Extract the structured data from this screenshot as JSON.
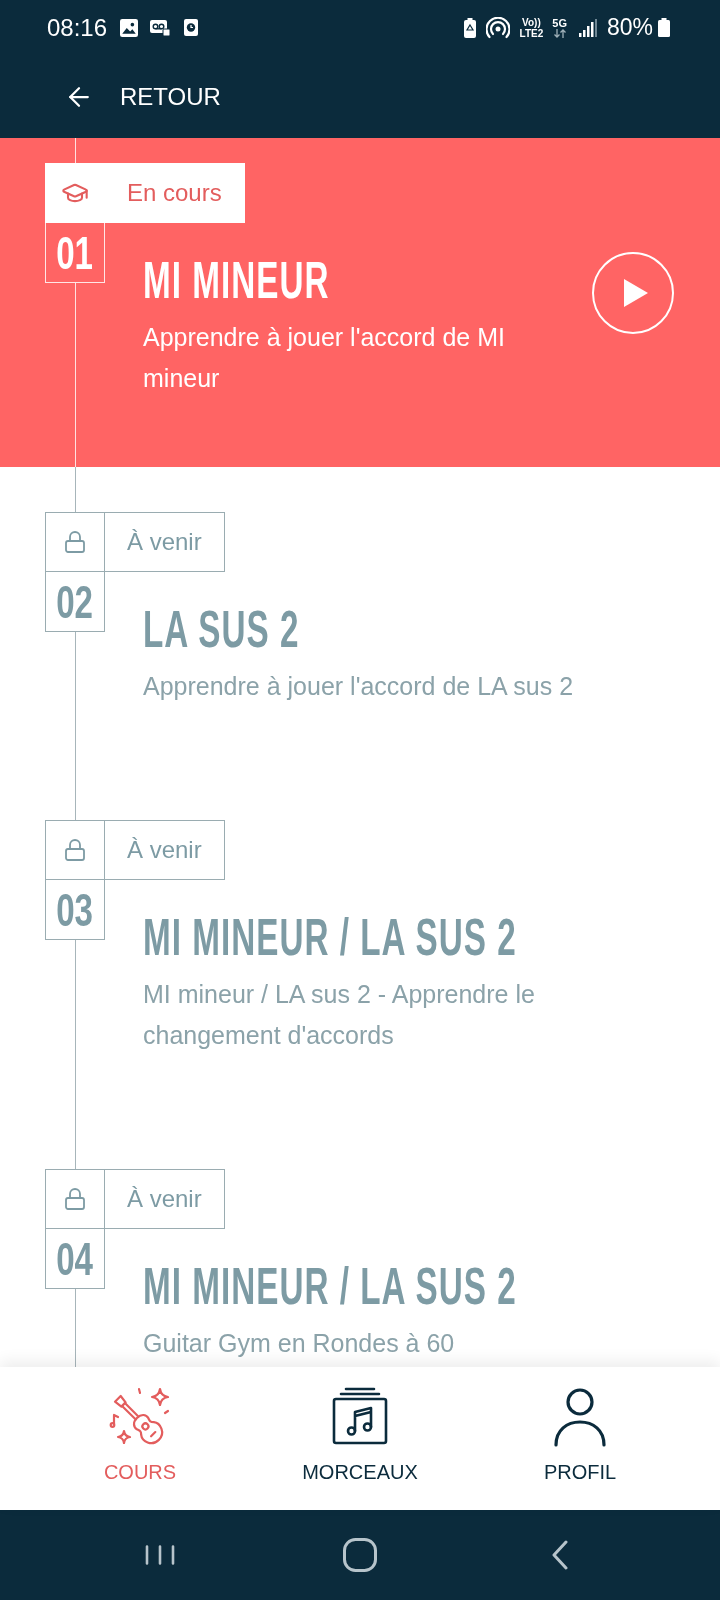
{
  "status_bar": {
    "time": "08:16",
    "volte": [
      "Vo))",
      "LTE2"
    ],
    "network_type": "5G",
    "battery": "80%"
  },
  "header": {
    "back_label": "RETOUR"
  },
  "lessons": [
    {
      "kind": "current",
      "status": "En cours",
      "number": "01",
      "title": "MI MINEUR",
      "description": "Apprendre à jouer l'accord de MI mineur"
    },
    {
      "kind": "locked",
      "status": "À venir",
      "number": "02",
      "title": "LA SUS 2",
      "description": "Apprendre à jouer l'accord de LA sus 2"
    },
    {
      "kind": "locked",
      "status": "À venir",
      "number": "03",
      "title": "MI MINEUR / LA SUS 2",
      "description": "MI mineur / LA sus 2 - Apprendre le changement d'accords"
    },
    {
      "kind": "locked",
      "status": "À venir",
      "number": "04",
      "title": "MI MINEUR / LA SUS 2",
      "description": "Guitar Gym en Rondes à 60"
    }
  ],
  "bottom_nav": [
    {
      "label": "COURS",
      "selected": true
    },
    {
      "label": "MORCEAUX",
      "selected": false
    },
    {
      "label": "PROFIL",
      "selected": false
    }
  ]
}
